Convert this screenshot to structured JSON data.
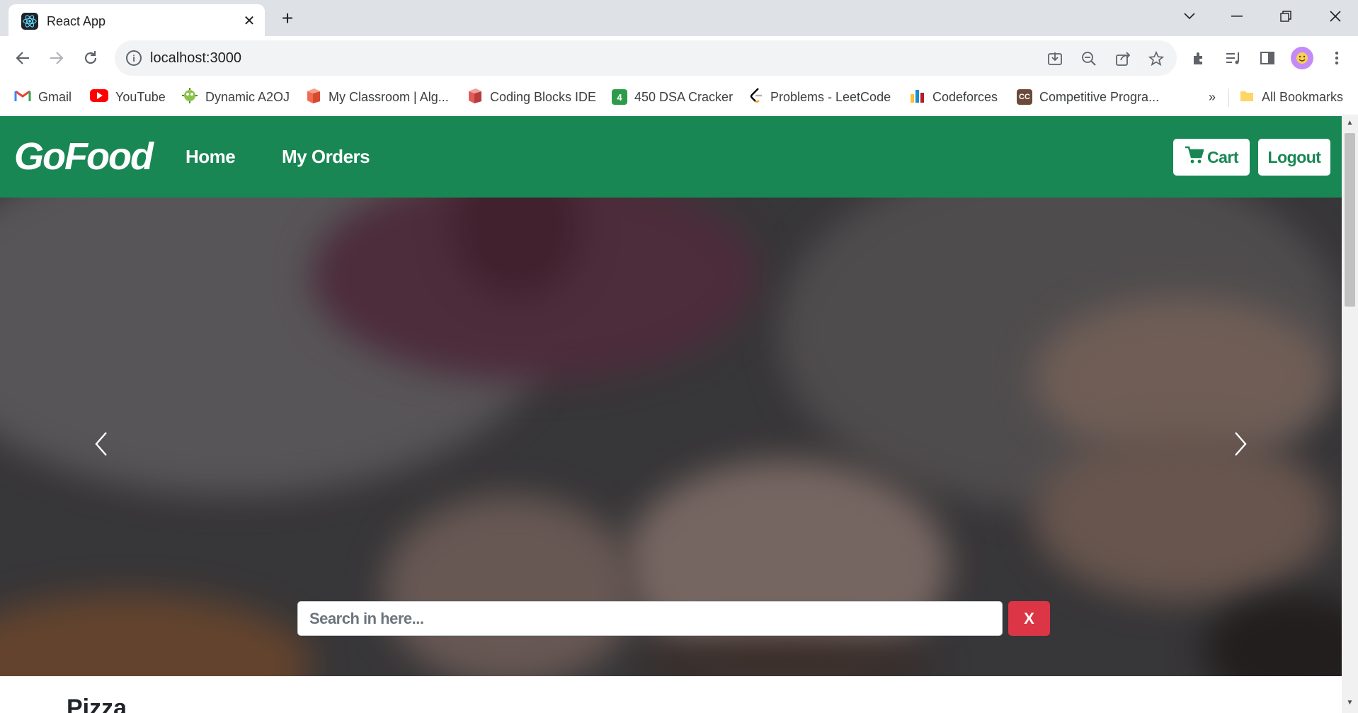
{
  "browser": {
    "tab_title": "React App",
    "tab_close": "✕",
    "new_tab": "+",
    "url": "localhost:3000",
    "bookmarks": [
      {
        "label": "Gmail",
        "icon": "gmail-icon"
      },
      {
        "label": "YouTube",
        "icon": "youtube-icon"
      },
      {
        "label": "Dynamic A2OJ",
        "icon": "a2oj-icon"
      },
      {
        "label": "My Classroom | Alg...",
        "icon": "classroom-icon"
      },
      {
        "label": "Coding Blocks IDE",
        "icon": "codingblocks-icon"
      },
      {
        "label": "450 DSA Cracker",
        "icon": "dsa-cracker-icon",
        "badge": "4"
      },
      {
        "label": "Problems - LeetCode",
        "icon": "leetcode-icon"
      },
      {
        "label": "Codeforces",
        "icon": "codeforces-icon"
      },
      {
        "label": "Competitive Progra...",
        "icon": "cc-icon",
        "badge": "CC"
      }
    ],
    "bookmarks_overflow": "»",
    "all_bookmarks": "All Bookmarks"
  },
  "app": {
    "brand": "GoFood",
    "nav": {
      "home": "Home",
      "my_orders": "My Orders"
    },
    "cart_label": "Cart",
    "logout_label": "Logout",
    "search_placeholder": "Search in here...",
    "clear_label": "X",
    "section_title": "Pizza"
  },
  "colors": {
    "primary": "#198754",
    "danger": "#dc3545",
    "chrome_tabstrip": "#dee1e6"
  }
}
